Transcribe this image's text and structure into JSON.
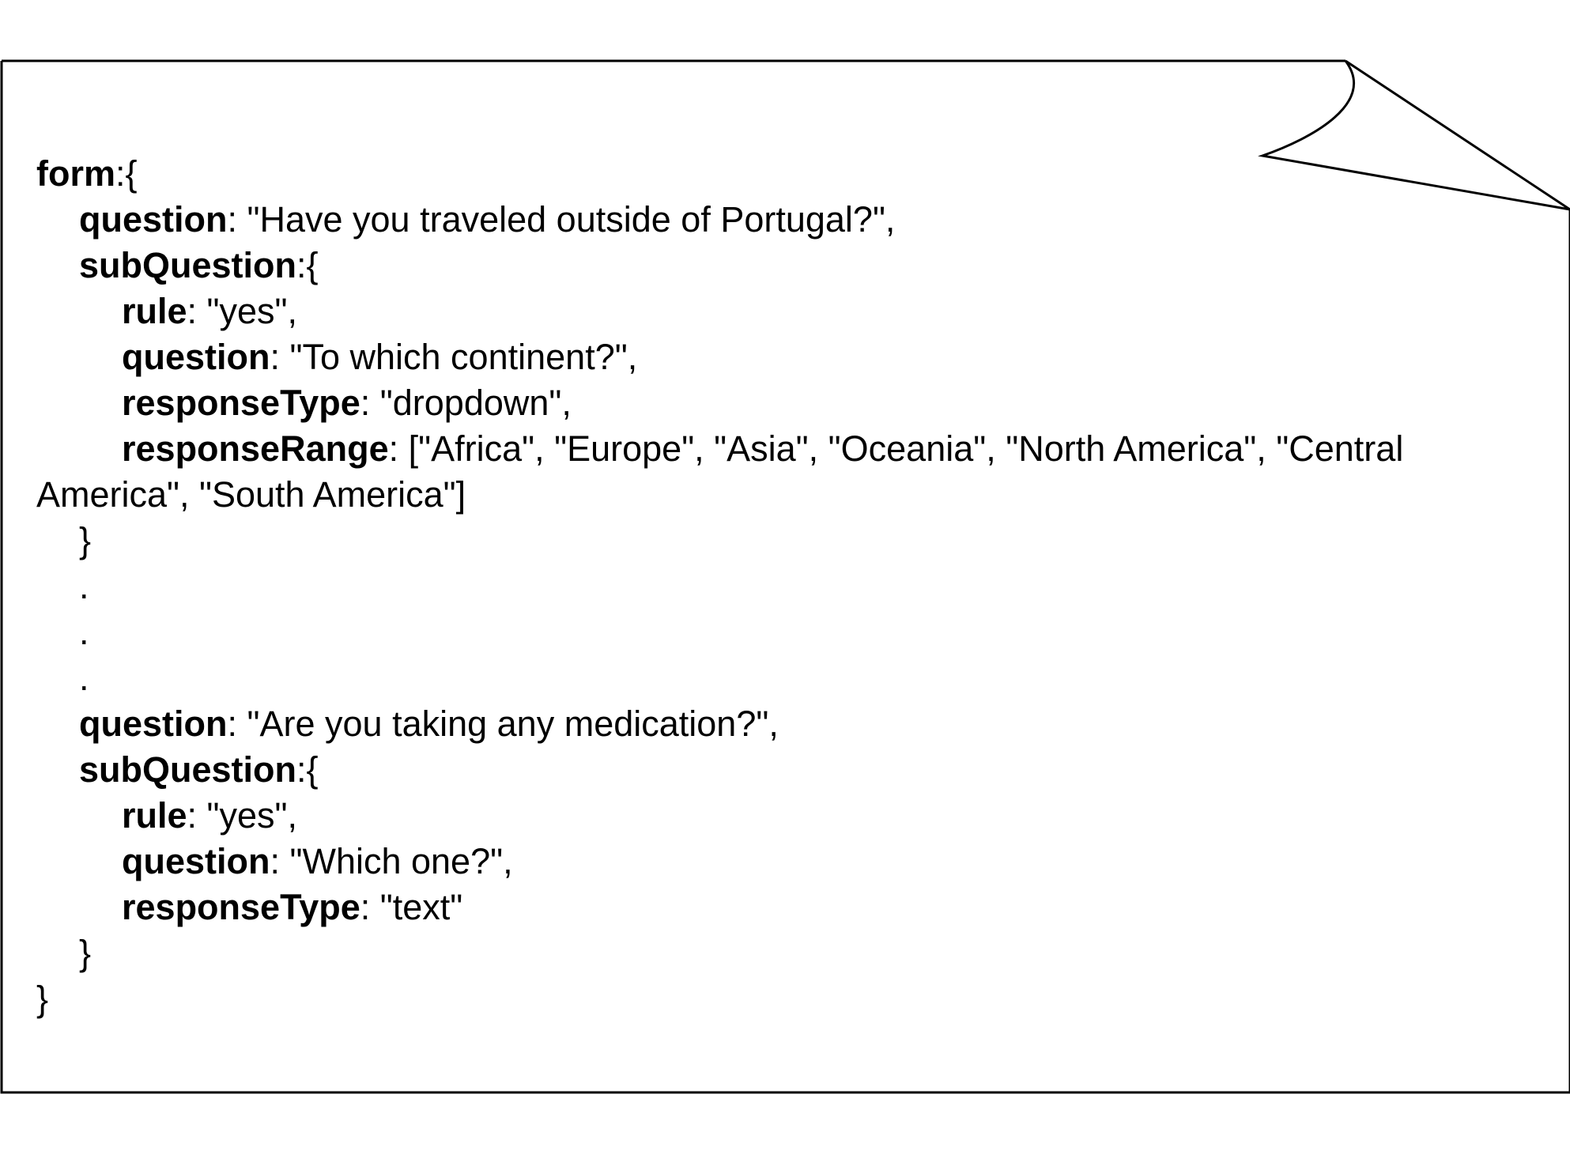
{
  "code": {
    "line01": {
      "key": "form",
      "rest": ":{"
    },
    "line02": {
      "key": "question",
      "rest": ": \"Have you traveled outside of Portugal?\","
    },
    "line03": {
      "key": "subQuestion",
      "rest": ":{"
    },
    "line04": {
      "key": "rule",
      "rest": ": \"yes\","
    },
    "line05": {
      "key": "question",
      "rest": ": \"To which continent?\","
    },
    "line06": {
      "key": "responseType",
      "rest": ": \"dropdown\","
    },
    "line07": {
      "key": "responseRange",
      "rest": ": [\"Africa\", \"Europe\", \"Asia\", \"Oceania\", \"North America\", \"Central America\", \"South America\"]"
    },
    "line08": {
      "text": "}"
    },
    "line09": {
      "text": "."
    },
    "line10": {
      "text": "."
    },
    "line11": {
      "text": "."
    },
    "line12": {
      "key": "question",
      "rest": ": \"Are you taking any medication?\","
    },
    "line13": {
      "key": "subQuestion",
      "rest": ":{"
    },
    "line14": {
      "key": "rule",
      "rest": ": \"yes\","
    },
    "line15": {
      "key": "question",
      "rest": ": \"Which one?\","
    },
    "line16": {
      "key": "responseType",
      "rest": ": \"text\""
    },
    "line17": {
      "text": "}"
    },
    "line18": {
      "text": "}"
    }
  }
}
